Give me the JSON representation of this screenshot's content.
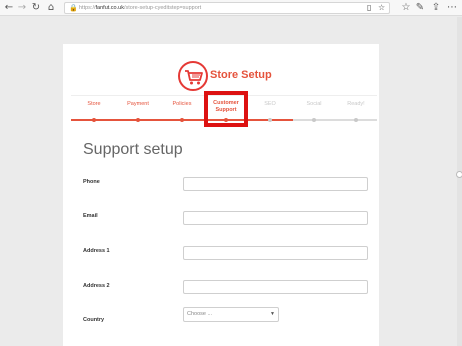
{
  "browser": {
    "url_domain": "fanfut.co.uk",
    "url_path": "/store-setup-cyeditstep=support",
    "url_scheme": "https://",
    "icons": [
      "back-arrow-icon",
      "forward-arrow-icon",
      "refresh-icon",
      "home-icon",
      "lock-icon",
      "reading-view-icon",
      "favorite-star-icon",
      "favorites-bar-icon",
      "pen-icon",
      "share-icon",
      "more-icon"
    ]
  },
  "brand": {
    "name": "Store Setup",
    "logo_icon": "shopping-cart-icon",
    "accent_color": "#e5533c",
    "highlight_color": "#dd1111"
  },
  "steps": [
    {
      "label": "Store",
      "state": "done"
    },
    {
      "label": "Payment",
      "state": "done"
    },
    {
      "label": "Policies",
      "state": "done"
    },
    {
      "label": "Customer Support",
      "state": "active"
    },
    {
      "label": "SEO",
      "state": "todo"
    },
    {
      "label": "Social",
      "state": "todo"
    },
    {
      "label": "Ready!",
      "state": "todo"
    }
  ],
  "form": {
    "title": "Support setup",
    "fields": [
      {
        "label": "Phone",
        "value": ""
      },
      {
        "label": "Email",
        "value": ""
      },
      {
        "label": "Address 1",
        "value": ""
      },
      {
        "label": "Address 2",
        "value": ""
      }
    ],
    "country": {
      "label": "Country",
      "selected": "Choose ..."
    }
  }
}
